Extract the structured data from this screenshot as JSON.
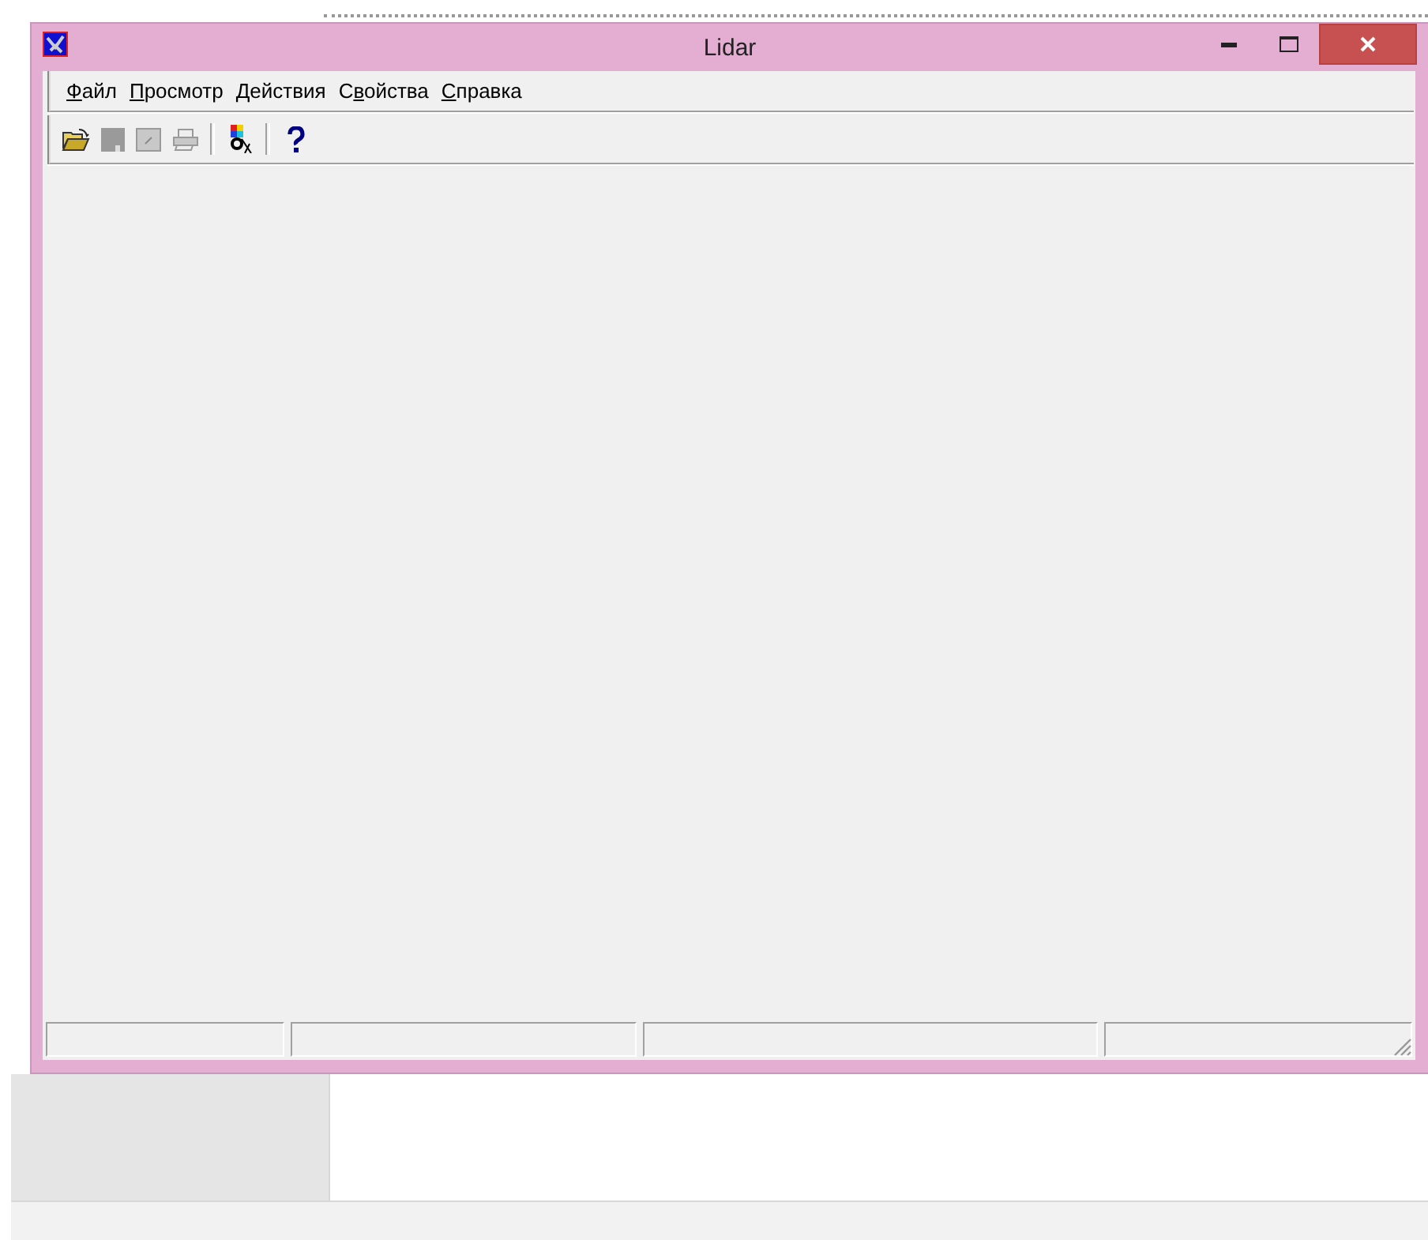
{
  "window": {
    "title": "Lidar"
  },
  "menu": [
    {
      "runs": [
        {
          "text": "Ф",
          "underline": true
        },
        {
          "text": "айл",
          "underline": false
        }
      ]
    },
    {
      "runs": [
        {
          "text": "П",
          "underline": true
        },
        {
          "text": "росмотр",
          "underline": false
        }
      ]
    },
    {
      "runs": [
        {
          "text": "Действия",
          "underline": false
        }
      ]
    },
    {
      "runs": [
        {
          "text": "С",
          "underline": false
        },
        {
          "text": "в",
          "underline": true
        },
        {
          "text": "ойства",
          "underline": false
        }
      ]
    },
    {
      "runs": [
        {
          "text": "С",
          "underline": true
        },
        {
          "text": "правка",
          "underline": false
        }
      ]
    }
  ],
  "toolbar": [
    {
      "kind": "open",
      "disabled": false
    },
    {
      "kind": "save",
      "disabled": true
    },
    {
      "kind": "edit",
      "disabled": true
    },
    {
      "kind": "print",
      "disabled": true
    },
    {
      "kind": "separator"
    },
    {
      "kind": "palette",
      "disabled": false
    },
    {
      "kind": "separator"
    },
    {
      "kind": "help",
      "disabled": false
    }
  ],
  "status_bar": {
    "panes": [
      {
        "kind": "pane"
      },
      {
        "kind": "pane"
      },
      {
        "kind": "pane"
      },
      {
        "kind": "pane"
      }
    ]
  }
}
